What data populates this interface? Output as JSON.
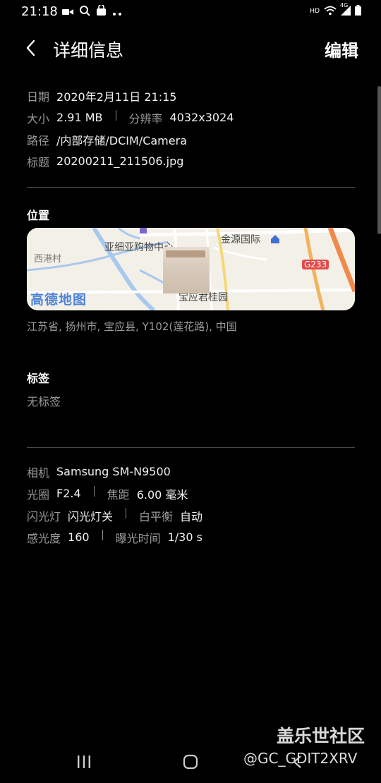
{
  "status_bar": {
    "time": "21:18",
    "left_icons": [
      "video-icon",
      "search-icon",
      "shopping-bag-icon",
      "more-dots-icon"
    ],
    "right_icons": [
      "hd-icon",
      "wifi-icon",
      "signal-4g-icon",
      "battery-icon"
    ],
    "hd_text": "HD",
    "net_text": "4G"
  },
  "header": {
    "title": "详细信息",
    "edit_label": "编辑"
  },
  "details": {
    "date_label": "日期",
    "date_value": "2020年2月11日 21:15",
    "size_label": "大小",
    "size_value": "2.91 MB",
    "resolution_label": "分辨率",
    "resolution_value": "4032x3024",
    "path_label": "路径",
    "path_value": "/内部存储/DCIM/Camera",
    "filename_label": "标题",
    "filename_value": "20200211_211506.jpg"
  },
  "location": {
    "section_title": "位置",
    "map_labels": {
      "mall": "亚细亚购物中心",
      "jinyuan": "金源国际",
      "xigang": "西港村",
      "garden": "宝应君桂园",
      "road": "G233",
      "logo": "高德地图"
    },
    "address": "江苏省, 扬州市, 宝应县, Y102(莲花路), 中国"
  },
  "tags": {
    "section_title": "标签",
    "value": "无标签"
  },
  "camera": {
    "camera_label": "相机",
    "camera_value": "Samsung SM-N9500",
    "aperture_label": "光圈",
    "aperture_value": "F2.4",
    "focal_label": "焦距",
    "focal_value": "6.00 毫米",
    "flash_label": "闪光灯",
    "flash_value": "闪光灯关",
    "wb_label": "白平衡",
    "wb_value": "自动",
    "iso_label": "感光度",
    "iso_value": "160",
    "exposure_label": "曝光时间",
    "exposure_value": "1/30 s"
  },
  "watermark": {
    "site": "盖乐世社区",
    "user": "@GC_GDIT2XRV"
  }
}
